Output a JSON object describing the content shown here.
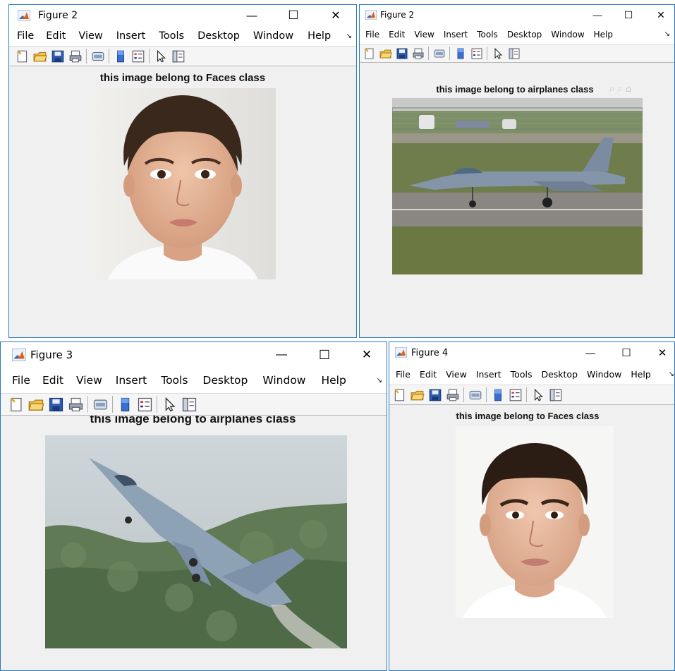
{
  "menu": [
    "File",
    "Edit",
    "View",
    "Insert",
    "Tools",
    "Desktop",
    "Window",
    "Help"
  ],
  "controls": {
    "minimize": "—",
    "maximize": "☐",
    "close": "✕"
  },
  "menu_overflow": "↘",
  "colors": {
    "border": "#2b79c2",
    "window_bg": "#f0f0f0",
    "titlebar_bg": "#ffffff"
  },
  "windows": [
    {
      "window_title": "Figure 2",
      "axes_title": "this image belong to Faces class",
      "image": "female-face-photo"
    },
    {
      "window_title": "Figure 2",
      "axes_title": "this image belong to airplanes class",
      "image": "jet-on-runway-photo",
      "faded_icons": "⌕ ⌕ ⌂"
    },
    {
      "window_title": "Figure 3",
      "axes_title": "this image belong to airplanes class",
      "image": "jet-climbing-photo"
    },
    {
      "window_title": "Figure 4",
      "axes_title": "this image belong to Faces class",
      "image": "male-face-photo"
    }
  ]
}
